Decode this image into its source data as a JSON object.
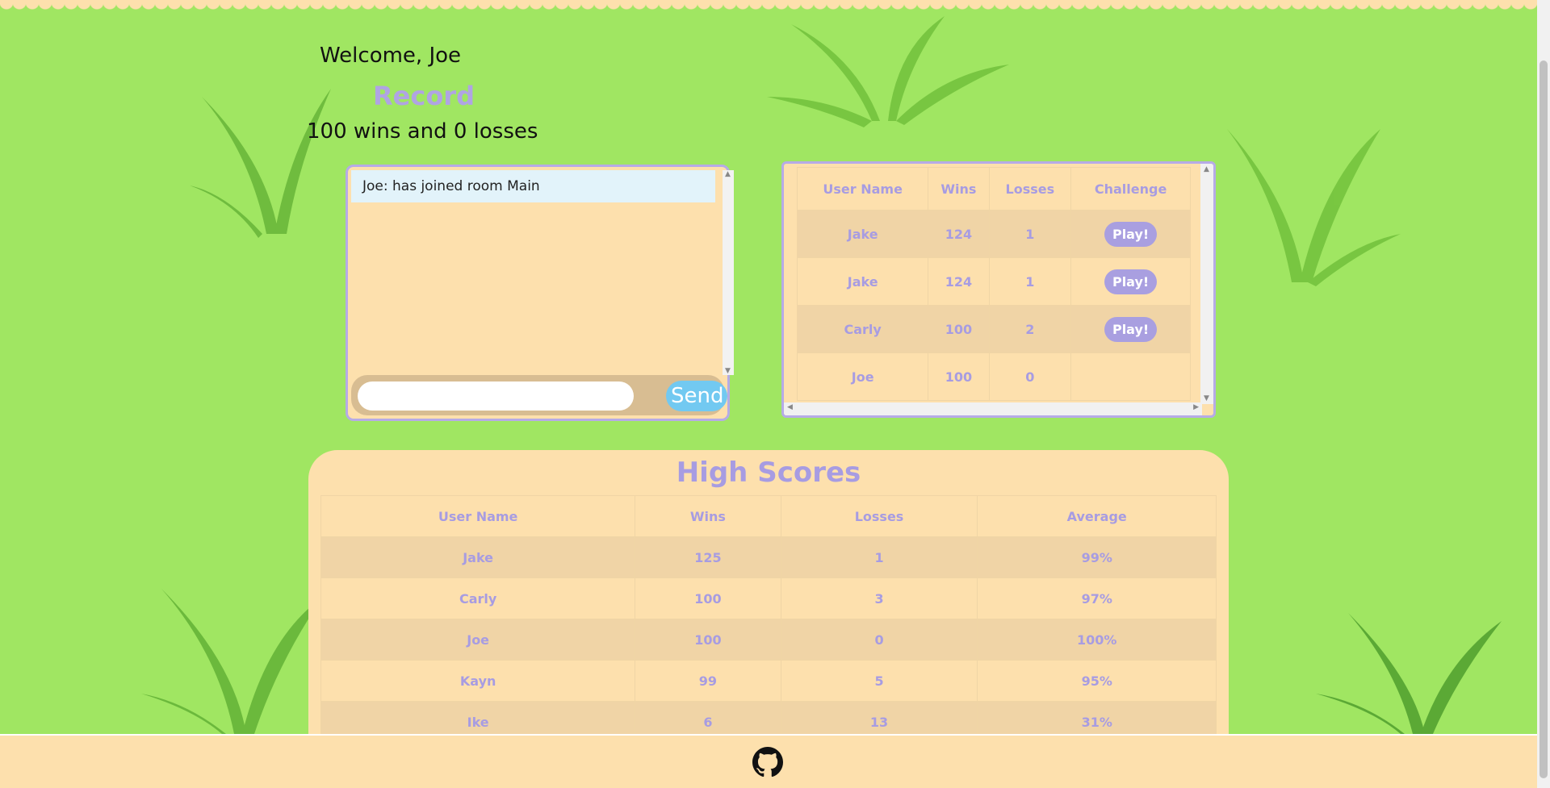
{
  "user": {
    "welcome": "Welcome, Joe"
  },
  "record": {
    "title": "Record",
    "summary": "100 wins and 0 losses"
  },
  "chat": {
    "messages": [
      "Joe: has joined room Main"
    ],
    "input_value": "",
    "send_label": "Send"
  },
  "lobby": {
    "headers": [
      "User Name",
      "Wins",
      "Losses",
      "Challenge"
    ],
    "rows": [
      {
        "name": "Jake",
        "wins": "124",
        "losses": "1",
        "action": "Play!"
      },
      {
        "name": "Jake",
        "wins": "124",
        "losses": "1",
        "action": "Play!"
      },
      {
        "name": "Carly",
        "wins": "100",
        "losses": "2",
        "action": "Play!"
      },
      {
        "name": "Joe",
        "wins": "100",
        "losses": "0",
        "action": ""
      }
    ]
  },
  "high_scores": {
    "title": "High Scores",
    "headers": [
      "User Name",
      "Wins",
      "Losses",
      "Average"
    ],
    "rows": [
      {
        "name": "Jake",
        "wins": "125",
        "losses": "1",
        "average": "99%"
      },
      {
        "name": "Carly",
        "wins": "100",
        "losses": "3",
        "average": "97%"
      },
      {
        "name": "Joe",
        "wins": "100",
        "losses": "0",
        "average": "100%"
      },
      {
        "name": "Kayn",
        "wins": "99",
        "losses": "5",
        "average": "95%"
      },
      {
        "name": "Ike",
        "wins": "6",
        "losses": "13",
        "average": "31%"
      }
    ]
  },
  "footer": {
    "icon": "github-icon"
  },
  "colors": {
    "background": "#a0e662",
    "panel": "#fde0ad",
    "accent": "#a79ce2",
    "send": "#72c9f1"
  }
}
